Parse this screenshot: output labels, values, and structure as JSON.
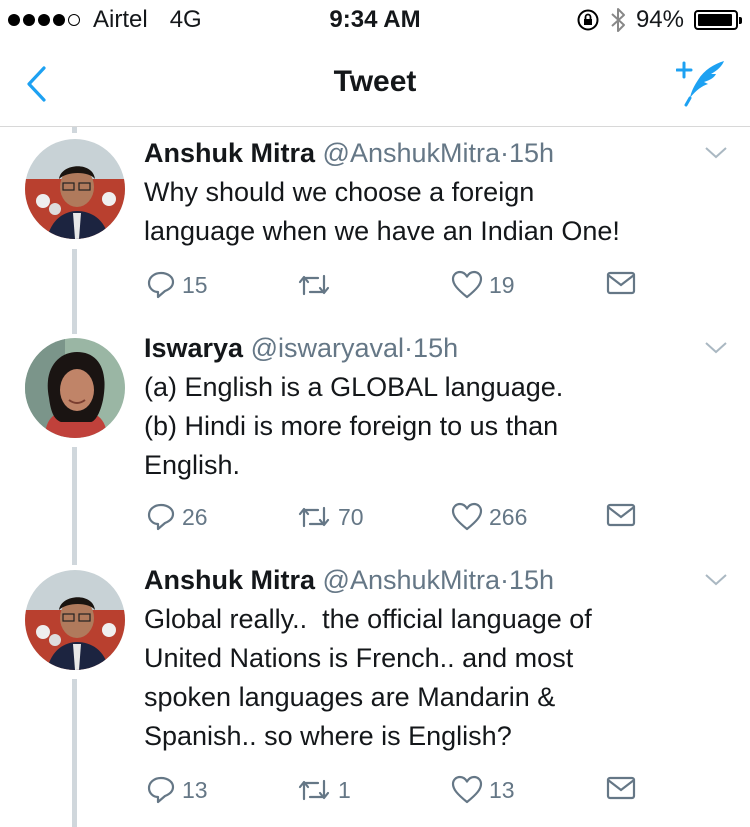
{
  "status_bar": {
    "carrier": "Airtel",
    "network": "4G",
    "time": "9:34 AM",
    "battery": "94%",
    "battery_level": 0.94,
    "signal_bars": 4,
    "icons": [
      "rotation-lock-icon",
      "bluetooth-icon",
      "battery-icon"
    ]
  },
  "nav": {
    "title": "Tweet",
    "back_icon": "chevron-left-icon",
    "compose_icon": "compose-tweet-icon",
    "accent_color": "#1da1f2"
  },
  "tweets": [
    {
      "name": "Anshuk Mitra",
      "handle": "@AnshukMitra",
      "separator": "·",
      "time": "15h",
      "lines": [
        "Why should we choose a foreign",
        "language when we have an Indian One!"
      ],
      "replies": "15",
      "retweets": "",
      "likes": "19"
    },
    {
      "name": "Iswarya",
      "handle": "@iswaryaval",
      "separator": "·",
      "time": "15h",
      "lines": [
        "(a) English is a GLOBAL language.",
        "(b) Hindi is more foreign to us than",
        "English."
      ],
      "replies": "26",
      "retweets": "70",
      "likes": "266"
    },
    {
      "name": "Anshuk Mitra",
      "handle": "@AnshukMitra",
      "separator": "·",
      "time": "15h",
      "lines": [
        "Global really..  the official language of",
        "United Nations is French.. and most",
        "spoken languages are Mandarin &",
        "Spanish.. so where is English?"
      ],
      "replies": "13",
      "retweets": "1",
      "likes": "13"
    }
  ]
}
